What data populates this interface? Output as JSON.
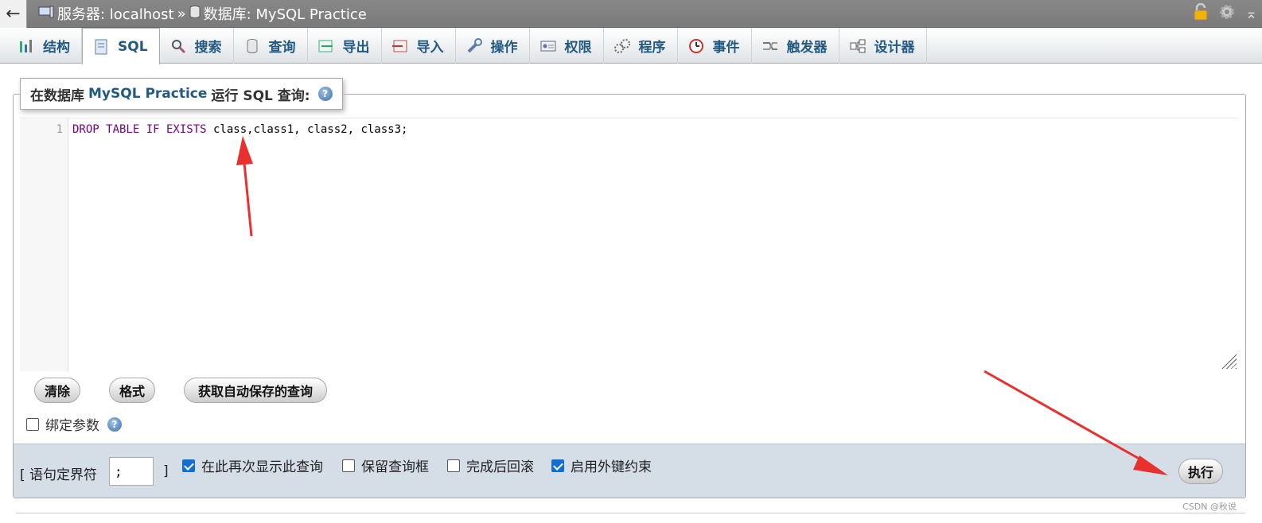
{
  "breadcrumb": {
    "back": "←",
    "server_label": "服务器: localhost",
    "separator": "»",
    "database_label": "数据库: MySQL Practice"
  },
  "tabs": [
    {
      "label": "结构",
      "icon": "structure-icon"
    },
    {
      "label": "SQL",
      "icon": "sql-icon",
      "active": true
    },
    {
      "label": "搜索",
      "icon": "search-icon"
    },
    {
      "label": "查询",
      "icon": "query-icon"
    },
    {
      "label": "导出",
      "icon": "export-icon"
    },
    {
      "label": "导入",
      "icon": "import-icon"
    },
    {
      "label": "操作",
      "icon": "wrench-icon"
    },
    {
      "label": "权限",
      "icon": "privileges-icon"
    },
    {
      "label": "程序",
      "icon": "routines-icon"
    },
    {
      "label": "事件",
      "icon": "clock-icon"
    },
    {
      "label": "触发器",
      "icon": "triggers-icon"
    },
    {
      "label": "设计器",
      "icon": "designer-icon"
    }
  ],
  "query_panel": {
    "legend_prefix": "在数据库",
    "legend_db": "MySQL Practice",
    "legend_suffix": "运行 SQL 查询:",
    "line_number": "1",
    "sql_keywords": "DROP TABLE IF EXISTS",
    "sql_rest": " class,class1, class2, class3;"
  },
  "buttons": {
    "clear": "清除",
    "format": "格式",
    "get_autosaved": "获取自动保存的查询",
    "execute": "执行"
  },
  "bind_params": {
    "label": "绑定参数",
    "checked": false
  },
  "options": {
    "delimiter_open": "[ 语句定界符",
    "delimiter_value": ";",
    "delimiter_close": "]",
    "show_again": {
      "label": "在此再次显示此查询",
      "checked": true
    },
    "retain_box": {
      "label": "保留查询框",
      "checked": false
    },
    "rollback": {
      "label": "完成后回滚",
      "checked": false
    },
    "foreign_keys": {
      "label": "启用外键约束",
      "checked": true
    }
  },
  "watermark": "CSDN @秋说",
  "colors": {
    "accent": "#235a81",
    "keyword": "#770088",
    "annotation_arrow": "#e8312f"
  }
}
